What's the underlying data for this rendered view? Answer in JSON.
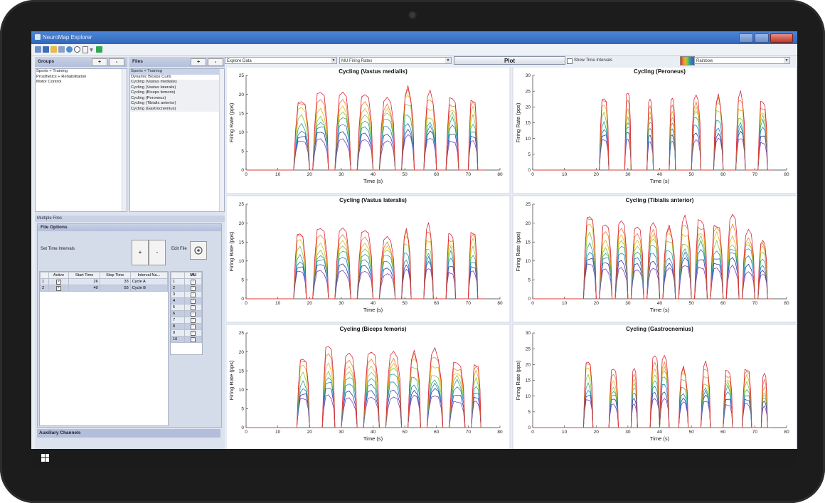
{
  "window": {
    "title": "NeuroMap Explorer",
    "controls": {
      "minimize": "—",
      "maximize": "□",
      "close": "✕"
    }
  },
  "toolbar_icons": [
    "open-icon",
    "save-icon",
    "folder-icon",
    "table-icon",
    "globe-icon",
    "zoom-icon",
    "page-icon",
    "dropdown-icon",
    "status-icon"
  ],
  "groups": {
    "header": "Groups",
    "add_label": "+",
    "remove_label": "-",
    "items": [
      "Sports + Training",
      "Prosthetics + Rehabilitation",
      "Motor Control"
    ]
  },
  "files": {
    "header": "Files",
    "add_label": "+",
    "remove_label": "-",
    "group_label": "Sports + Training",
    "items": [
      "Dynamic Biceps Curls",
      "Cycling (Vastus medialis)",
      "Cycling (Vastus lateralis)",
      "Cycling (Biceps femoris)",
      "Cycling (Peroneus)",
      "Cycling (Tibialis anterior)",
      "Cycling (Gastrocnemius)"
    ]
  },
  "multiple_files_label": "Multiple Files",
  "file_options": {
    "header": "File Options",
    "set_time_intervals": "Set Time Intervals",
    "plus": "+",
    "minus": "-",
    "edit_file": "Edit File",
    "interval_table": {
      "columns": [
        "",
        "Active",
        "Start Time",
        "Stop Time",
        "Interval Na..."
      ],
      "rows": [
        {
          "idx": "1",
          "active": "✓",
          "start": "26",
          "stop": "33",
          "name": "Cycle A"
        },
        {
          "idx": "2",
          "active": "✓",
          "start": "40",
          "stop": "55",
          "name": "Cycle B"
        }
      ]
    },
    "mu_table": {
      "header": "MU",
      "rows": [
        "1",
        "2",
        "3",
        "4",
        "5",
        "6",
        "7",
        "8",
        "9",
        "10"
      ],
      "check": "✓"
    }
  },
  "auxiliary_channels": "Auxiliary Channels",
  "controls": {
    "explore_data": "Explore Data",
    "mu_firing_rates": "MU Firing Rates",
    "plot_button": "Plot",
    "show_time_intervals": "Show Time Intervals",
    "colormap": "Rainbow",
    "dropdown_arrow": "▼"
  },
  "chart_data": [
    {
      "type": "line",
      "title": "Cycling (Vastus medialis)",
      "xlabel": "Time (s)",
      "ylabel": "Firing Rate (pps)",
      "xlim": [
        0,
        80
      ],
      "ylim": [
        0,
        25
      ],
      "xticks": [
        0,
        10,
        20,
        30,
        40,
        50,
        60,
        70,
        80
      ],
      "yticks": [
        0,
        5,
        10,
        15,
        20,
        25
      ],
      "bursts": [
        [
          15,
          20,
          20
        ],
        [
          21,
          26,
          21
        ],
        [
          28,
          33,
          22
        ],
        [
          35,
          40,
          21
        ],
        [
          42,
          47,
          21
        ],
        [
          49,
          53,
          24
        ],
        [
          56,
          60,
          21
        ],
        [
          63,
          67,
          21
        ],
        [
          70,
          73,
          20
        ]
      ],
      "n_series": 8
    },
    {
      "type": "line",
      "title": "Cycling (Peroneus)",
      "xlabel": "Time (s)",
      "ylabel": "Firing Rate (pps)",
      "xlim": [
        0,
        80
      ],
      "ylim": [
        0,
        30
      ],
      "xticks": [
        0,
        10,
        20,
        30,
        40,
        50,
        60,
        70,
        80
      ],
      "yticks": [
        0,
        5,
        10,
        15,
        20,
        25,
        30
      ],
      "bursts": [
        [
          21,
          24,
          25
        ],
        [
          29,
          31,
          25
        ],
        [
          36,
          38,
          24
        ],
        [
          43,
          45,
          24
        ],
        [
          50,
          53,
          26
        ],
        [
          57,
          60,
          26
        ],
        [
          64,
          67,
          25
        ],
        [
          71,
          74,
          24
        ]
      ],
      "n_series": 8
    },
    {
      "type": "line",
      "title": "Cycling (Vastus lateralis)",
      "xlabel": "Time (s)",
      "ylabel": "Firing Rate (pps)",
      "xlim": [
        0,
        80
      ],
      "ylim": [
        0,
        25
      ],
      "xticks": [
        0,
        10,
        20,
        30,
        40,
        50,
        60,
        70,
        80
      ],
      "yticks": [
        0,
        5,
        10,
        15,
        20,
        25
      ],
      "bursts": [
        [
          15,
          19,
          19
        ],
        [
          21,
          26,
          19
        ],
        [
          28,
          33,
          20
        ],
        [
          35,
          40,
          19
        ],
        [
          42,
          47,
          18
        ],
        [
          49,
          52,
          20
        ],
        [
          56,
          59,
          20
        ],
        [
          63,
          66,
          19
        ],
        [
          70,
          73,
          19
        ]
      ],
      "n_series": 8
    },
    {
      "type": "line",
      "title": "Cycling (Tibialis anterior)",
      "xlabel": "Time (s)",
      "ylabel": "Firing Rate (pps)",
      "xlim": [
        0,
        80
      ],
      "ylim": [
        0,
        25
      ],
      "xticks": [
        0,
        10,
        20,
        30,
        40,
        50,
        60,
        70,
        80
      ],
      "yticks": [
        0,
        5,
        10,
        15,
        20,
        25
      ],
      "bursts": [
        [
          16,
          20,
          24
        ],
        [
          21,
          25,
          20
        ],
        [
          26,
          30,
          22
        ],
        [
          31,
          35,
          20
        ],
        [
          36,
          40,
          22
        ],
        [
          41,
          45,
          21
        ],
        [
          46,
          50,
          22
        ],
        [
          51,
          55,
          23
        ],
        [
          56,
          60,
          21
        ],
        [
          61,
          65,
          22
        ],
        [
          66,
          70,
          20
        ],
        [
          71,
          74,
          17
        ]
      ],
      "n_series": 8
    },
    {
      "type": "line",
      "title": "Cycling (Biceps femoris)",
      "xlabel": "Time (s)",
      "ylabel": "Firing Rate (pps)",
      "xlim": [
        0,
        80
      ],
      "ylim": [
        0,
        25
      ],
      "xticks": [
        0,
        10,
        20,
        30,
        40,
        50,
        60,
        70,
        80
      ],
      "yticks": [
        0,
        5,
        10,
        15,
        20,
        25
      ],
      "bursts": [
        [
          16,
          20,
          20
        ],
        [
          24,
          28,
          22
        ],
        [
          30,
          35,
          21
        ],
        [
          37,
          42,
          21
        ],
        [
          44,
          49,
          22
        ],
        [
          51,
          55,
          22
        ],
        [
          57,
          62,
          21
        ],
        [
          64,
          69,
          19
        ],
        [
          71,
          74,
          18
        ]
      ],
      "n_series": 8
    },
    {
      "type": "line",
      "title": "Cycling (Gastrocnemius)",
      "xlabel": "Time (s)",
      "ylabel": "Firing Rate (pps)",
      "xlim": [
        0,
        80
      ],
      "ylim": [
        0,
        30
      ],
      "xticks": [
        0,
        10,
        20,
        30,
        40,
        50,
        60,
        70,
        80
      ],
      "yticks": [
        0,
        5,
        10,
        15,
        20,
        25,
        30
      ],
      "bursts": [
        [
          16,
          19,
          23
        ],
        [
          24,
          27,
          19
        ],
        [
          31,
          33,
          20
        ],
        [
          37,
          40,
          24
        ],
        [
          40,
          43,
          25
        ],
        [
          46,
          49,
          21
        ],
        [
          53,
          56,
          21
        ],
        [
          60,
          63,
          20
        ],
        [
          66,
          69,
          20
        ],
        [
          72,
          74,
          17
        ]
      ],
      "n_series": 8
    }
  ],
  "series_colors": [
    "#d7263d",
    "#f07b2a",
    "#e2b822",
    "#8cc63f",
    "#2ca58d",
    "#1f7fc2",
    "#2d3fa0",
    "#7a3fb4"
  ]
}
